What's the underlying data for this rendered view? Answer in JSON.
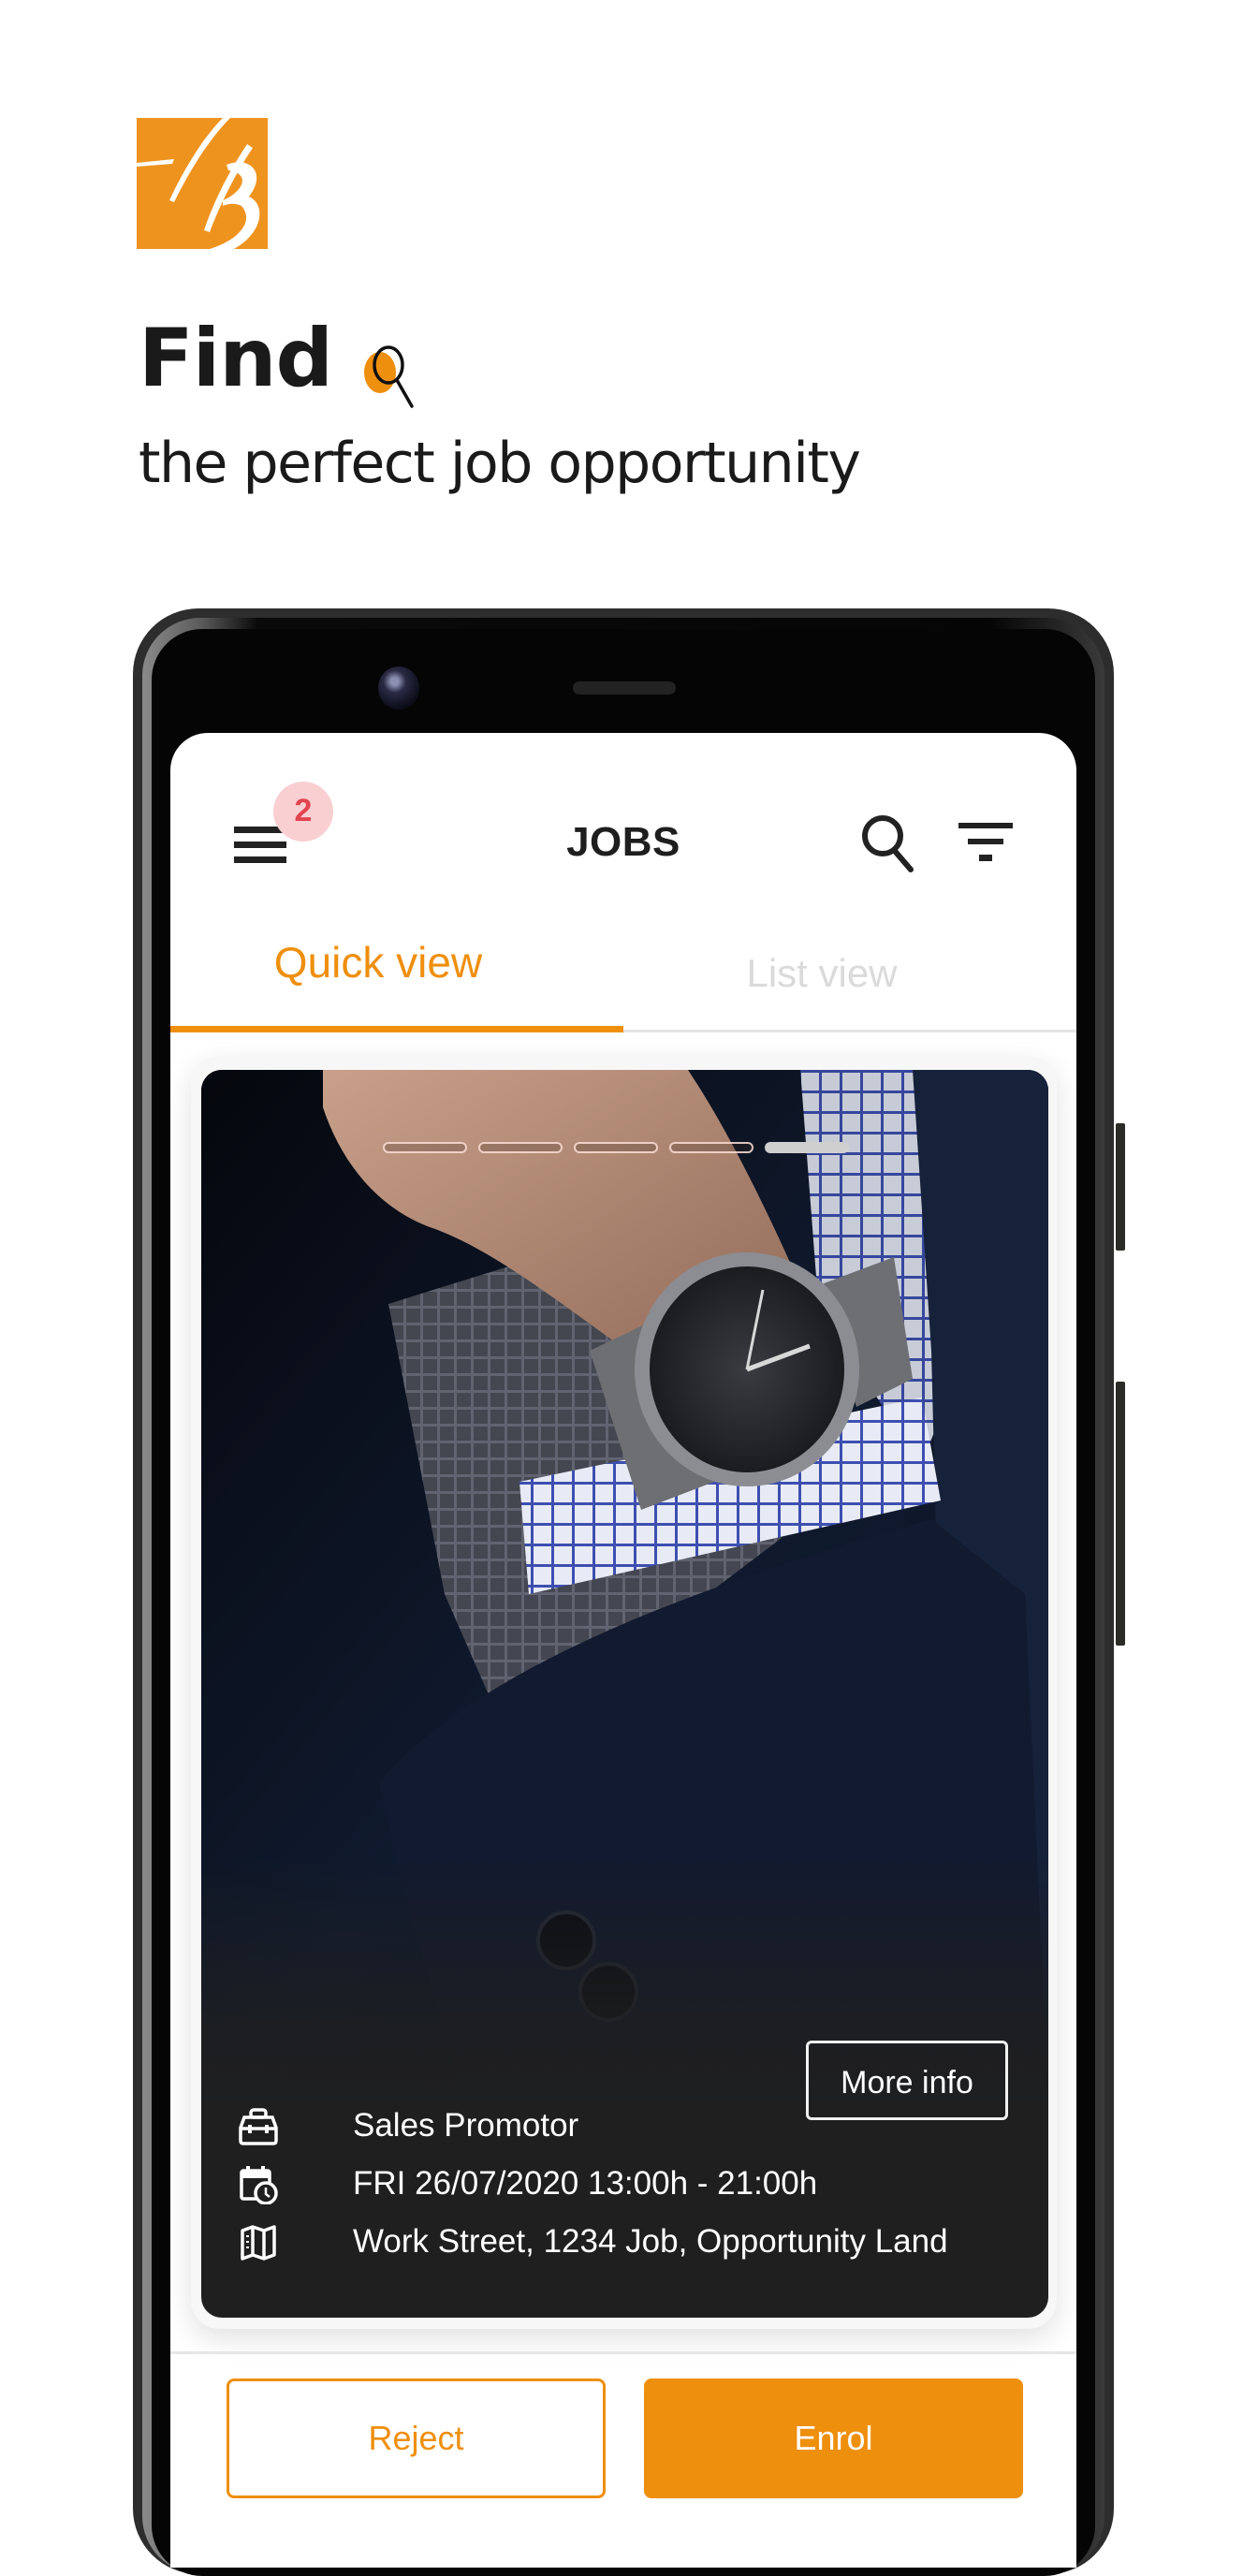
{
  "brand": {
    "logo_name": "hb-logo",
    "accent_color": "#EF8F0E",
    "logo_color": "#EF931F"
  },
  "promo": {
    "headline": "Find",
    "headline_icon": "search-icon",
    "subtitle": "the perfect job opportunity"
  },
  "app": {
    "header": {
      "title": "JOBS",
      "menu_icon": "hamburger-menu-icon",
      "notification_count": "2",
      "search_icon": "search-icon",
      "filter_icon": "filter-icon"
    },
    "tabs": [
      {
        "label": "Quick view",
        "active": true
      },
      {
        "label": "List view",
        "active": false
      }
    ],
    "job_card": {
      "image_description": "Man in navy suit with wristwatch and checkered shirt cuff",
      "carousel": {
        "total": 5,
        "active_index": 4
      },
      "more_info_label": "More info",
      "details": [
        {
          "icon": "toolbox-icon",
          "text": "Sales Promotor"
        },
        {
          "icon": "calendar-clock-icon",
          "text": "FRI 26/07/2020 13:00h - 21:00h"
        },
        {
          "icon": "map-icon",
          "text": "Work Street, 1234 Job, Opportunity Land"
        }
      ]
    },
    "actions": {
      "reject_label": "Reject",
      "enrol_label": "Enrol"
    }
  }
}
